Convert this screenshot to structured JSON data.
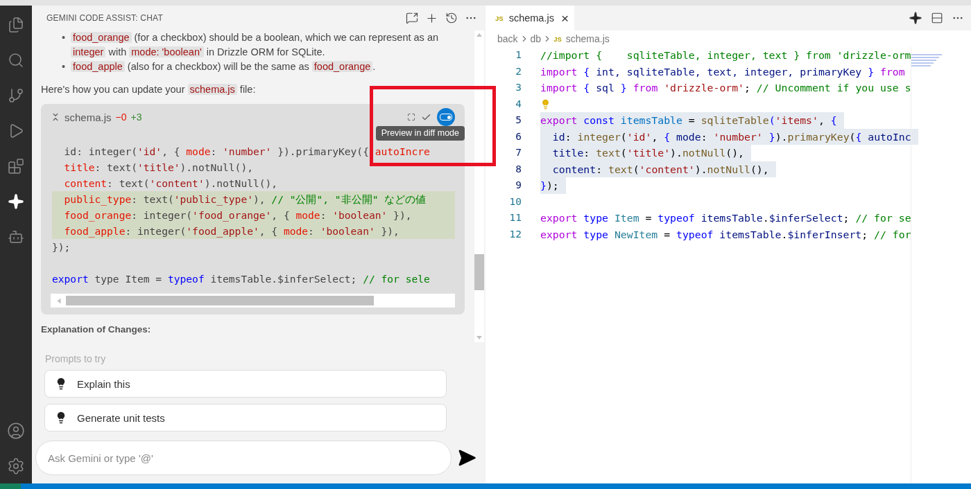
{
  "activity_bar": {
    "items": [
      {
        "selected": false
      },
      {
        "selected": false
      },
      {
        "selected": false
      },
      {
        "selected": false
      },
      {
        "selected": false
      },
      {
        "selected": true
      },
      {
        "selected": false
      }
    ]
  },
  "chat": {
    "title": "GEMINI CODE ASSIST: CHAT",
    "bullets": [
      {
        "marker": "•",
        "segments": [
          {
            "t": "food_orange",
            "code": true
          },
          {
            "t": " (for a checkbox) should be a boolean, which we can represent as an ",
            "code": false
          },
          {
            "t": "integer",
            "code": true
          },
          {
            "t": " with ",
            "code": false
          },
          {
            "t": "mode: 'boolean'",
            "code": true
          },
          {
            "t": " in Drizzle ORM for SQLite.",
            "code": false
          }
        ]
      },
      {
        "marker": "•",
        "segments": [
          {
            "t": "food_apple",
            "code": true
          },
          {
            "t": " (also for a checkbox) will be the same as ",
            "code": false
          },
          {
            "t": "food_orange",
            "code": true
          },
          {
            "t": ".",
            "code": false
          }
        ]
      }
    ],
    "intro": [
      {
        "t": "Here's how you can update your ",
        "code": false
      },
      {
        "t": "schema.js",
        "code": true
      },
      {
        "t": " file:",
        "code": false
      }
    ],
    "code_block": {
      "file": "schema.js",
      "removed": "−0",
      "added": "+3",
      "diff_preview_on": true,
      "tooltip": "Preview in diff mode",
      "lines": [
        {
          "added": false
        },
        {
          "added": false,
          "tokens": [
            {
              "t": "  id: integer(",
              "kind": "plain"
            },
            {
              "t": "'id'",
              "kind": "string"
            },
            {
              "t": ", { ",
              "kind": "plain"
            },
            {
              "t": "mode",
              "kind": "property"
            },
            {
              "t": ": ",
              "kind": "plain"
            },
            {
              "t": "'number'",
              "kind": "string"
            },
            {
              "t": " }).primaryKey({ ",
              "kind": "plain"
            },
            {
              "t": "autoIncre",
              "kind": "property"
            }
          ]
        },
        {
          "added": false,
          "tokens": [
            {
              "t": "  title",
              "kind": "property"
            },
            {
              "t": ": text(",
              "kind": "plain"
            },
            {
              "t": "'title'",
              "kind": "string"
            },
            {
              "t": ").notNull(),",
              "kind": "plain"
            }
          ]
        },
        {
          "added": false,
          "tokens": [
            {
              "t": "  content",
              "kind": "property"
            },
            {
              "t": ": text(",
              "kind": "plain"
            },
            {
              "t": "'content'",
              "kind": "string"
            },
            {
              "t": ").notNull(),",
              "kind": "plain"
            }
          ]
        },
        {
          "added": true,
          "tokens": [
            {
              "t": "  public_type",
              "kind": "property"
            },
            {
              "t": ": text(",
              "kind": "plain"
            },
            {
              "t": "'public_type'",
              "kind": "string"
            },
            {
              "t": "), ",
              "kind": "plain"
            },
            {
              "t": "// \"公開\", \"非公開\" などの値",
              "kind": "comment"
            }
          ]
        },
        {
          "added": true,
          "tokens": [
            {
              "t": "  food_orange",
              "kind": "property"
            },
            {
              "t": ": integer(",
              "kind": "plain"
            },
            {
              "t": "'food_orange'",
              "kind": "string"
            },
            {
              "t": ", { ",
              "kind": "plain"
            },
            {
              "t": "mode",
              "kind": "property"
            },
            {
              "t": ": ",
              "kind": "plain"
            },
            {
              "t": "'boolean'",
              "kind": "string"
            },
            {
              "t": " }),",
              "kind": "plain"
            }
          ]
        },
        {
          "added": true,
          "tokens": [
            {
              "t": "  food_apple",
              "kind": "property"
            },
            {
              "t": ": integer(",
              "kind": "plain"
            },
            {
              "t": "'food_apple'",
              "kind": "string"
            },
            {
              "t": ", { ",
              "kind": "plain"
            },
            {
              "t": "mode",
              "kind": "property"
            },
            {
              "t": ": ",
              "kind": "plain"
            },
            {
              "t": "'boolean'",
              "kind": "string"
            },
            {
              "t": " }),",
              "kind": "plain"
            }
          ]
        },
        {
          "added": false,
          "tokens": [
            {
              "t": "});",
              "kind": "plain"
            }
          ]
        },
        {
          "added": false
        },
        {
          "added": false,
          "tokens": [
            {
              "t": "export",
              "kind": "keyword"
            },
            {
              "t": " type Item = ",
              "kind": "plain"
            },
            {
              "t": "typeof",
              "kind": "keyword"
            },
            {
              "t": " itemsTable.$inferSelect; ",
              "kind": "plain"
            },
            {
              "t": "// for sele",
              "kind": "comment"
            }
          ]
        }
      ]
    },
    "explanation_heading": "Explanation of Changes:",
    "prompts_title": "Prompts to try",
    "prompts": [
      {
        "label": "Explain this"
      },
      {
        "label": "Generate unit tests"
      }
    ],
    "input": {
      "placeholder": "Ask Gemini or type '@'"
    }
  },
  "editor": {
    "tab": {
      "badge": "JS",
      "label": "schema.js",
      "close": "×"
    },
    "breadcrumb": [
      {
        "label": "back"
      },
      {
        "label": "db"
      },
      {
        "badge": "JS",
        "label": "schema.js"
      }
    ],
    "lines": [
      {
        "number": "1",
        "selected": false,
        "tokens": [
          {
            "t": "//import {    sqliteTable, integer, text } from 'drizzle-orm",
            "kind": "comment"
          }
        ]
      },
      {
        "number": "2",
        "selected": false,
        "tokens": [
          {
            "t": "import ",
            "kind": "control"
          },
          {
            "t": "{",
            "kind": "keyword"
          },
          {
            "t": " int, sqliteTable, text, integer, primaryKey ",
            "kind": "variable"
          },
          {
            "t": "}",
            "kind": "keyword"
          },
          {
            "t": " from",
            "kind": "control"
          }
        ]
      },
      {
        "number": "3",
        "selected": false,
        "tokens": [
          {
            "t": "import ",
            "kind": "control"
          },
          {
            "t": "{",
            "kind": "keyword"
          },
          {
            "t": " sql ",
            "kind": "variable"
          },
          {
            "t": "}",
            "kind": "keyword"
          },
          {
            "t": " from ",
            "kind": "control"
          },
          {
            "t": "'drizzle-orm'",
            "kind": "string"
          },
          {
            "t": "; ",
            "kind": "plain"
          },
          {
            "t": "// Uncomment if you use s",
            "kind": "comment"
          }
        ]
      },
      {
        "number": "4",
        "bulb": true
      },
      {
        "number": "5",
        "selected": true,
        "tokens": [
          {
            "t": "export",
            "kind": "control"
          },
          {
            "t": " const ",
            "kind": "keyword"
          },
          {
            "t": "itemsTable",
            "kind": "constant"
          },
          {
            "t": " = ",
            "kind": "plain"
          },
          {
            "t": "sqliteTable",
            "kind": "function"
          },
          {
            "t": "(",
            "kind": "keyword"
          },
          {
            "t": "'items'",
            "kind": "string"
          },
          {
            "t": ", ",
            "kind": "plain"
          },
          {
            "t": "{",
            "kind": "keyword"
          }
        ]
      },
      {
        "number": "6",
        "selected": true,
        "tokens": [
          {
            "t": "  id",
            "kind": "variable"
          },
          {
            "t": ": ",
            "kind": "plain"
          },
          {
            "t": "integer",
            "kind": "function"
          },
          {
            "t": "(",
            "kind": "plain"
          },
          {
            "t": "'id'",
            "kind": "string"
          },
          {
            "t": ", ",
            "kind": "plain"
          },
          {
            "t": "{",
            "kind": "keyword"
          },
          {
            "t": " mode",
            "kind": "variable"
          },
          {
            "t": ": ",
            "kind": "plain"
          },
          {
            "t": "'number'",
            "kind": "string"
          },
          {
            "t": " }",
            "kind": "keyword"
          },
          {
            "t": ").",
            "kind": "plain"
          },
          {
            "t": "primaryKey",
            "kind": "function"
          },
          {
            "t": "(",
            "kind": "plain"
          },
          {
            "t": "{",
            "kind": "keyword"
          },
          {
            "t": " autoInc",
            "kind": "variable"
          }
        ]
      },
      {
        "number": "7",
        "selected": true,
        "tokens": [
          {
            "t": "  title",
            "kind": "variable"
          },
          {
            "t": ": ",
            "kind": "plain"
          },
          {
            "t": "text",
            "kind": "function"
          },
          {
            "t": "(",
            "kind": "plain"
          },
          {
            "t": "'title'",
            "kind": "string"
          },
          {
            "t": ").",
            "kind": "plain"
          },
          {
            "t": "notNull",
            "kind": "function"
          },
          {
            "t": "(),",
            "kind": "plain"
          }
        ]
      },
      {
        "number": "8",
        "selected": true,
        "tokens": [
          {
            "t": "  content",
            "kind": "variable"
          },
          {
            "t": ": ",
            "kind": "plain"
          },
          {
            "t": "text",
            "kind": "function"
          },
          {
            "t": "(",
            "kind": "plain"
          },
          {
            "t": "'content'",
            "kind": "string"
          },
          {
            "t": ").",
            "kind": "plain"
          },
          {
            "t": "notNull",
            "kind": "function"
          },
          {
            "t": "(),",
            "kind": "plain"
          }
        ]
      },
      {
        "number": "9",
        "selected": true,
        "tokens": [
          {
            "t": "}",
            "kind": "keyword"
          },
          {
            "t": ");",
            "kind": "plain"
          }
        ]
      },
      {
        "number": "10"
      },
      {
        "number": "11",
        "selected": false,
        "tokens": [
          {
            "t": "export",
            "kind": "control"
          },
          {
            "t": " type ",
            "kind": "keyword"
          },
          {
            "t": "Item",
            "kind": "type"
          },
          {
            "t": " = ",
            "kind": "plain"
          },
          {
            "t": "typeof",
            "kind": "keyword"
          },
          {
            "t": " itemsTable",
            "kind": "variable"
          },
          {
            "t": ".",
            "kind": "plain"
          },
          {
            "t": "$inferSelect",
            "kind": "variable"
          },
          {
            "t": "; ",
            "kind": "plain"
          },
          {
            "t": "// for se",
            "kind": "comment"
          }
        ]
      },
      {
        "number": "12",
        "selected": false,
        "tokens": [
          {
            "t": "export",
            "kind": "control"
          },
          {
            "t": " type ",
            "kind": "keyword"
          },
          {
            "t": "NewItem",
            "kind": "type"
          },
          {
            "t": " = ",
            "kind": "plain"
          },
          {
            "t": "typeof",
            "kind": "keyword"
          },
          {
            "t": " itemsTable",
            "kind": "variable"
          },
          {
            "t": ".",
            "kind": "plain"
          },
          {
            "t": "$inferInsert",
            "kind": "variable"
          },
          {
            "t": "; ",
            "kind": "plain"
          },
          {
            "t": "// for",
            "kind": "comment"
          }
        ]
      }
    ]
  }
}
